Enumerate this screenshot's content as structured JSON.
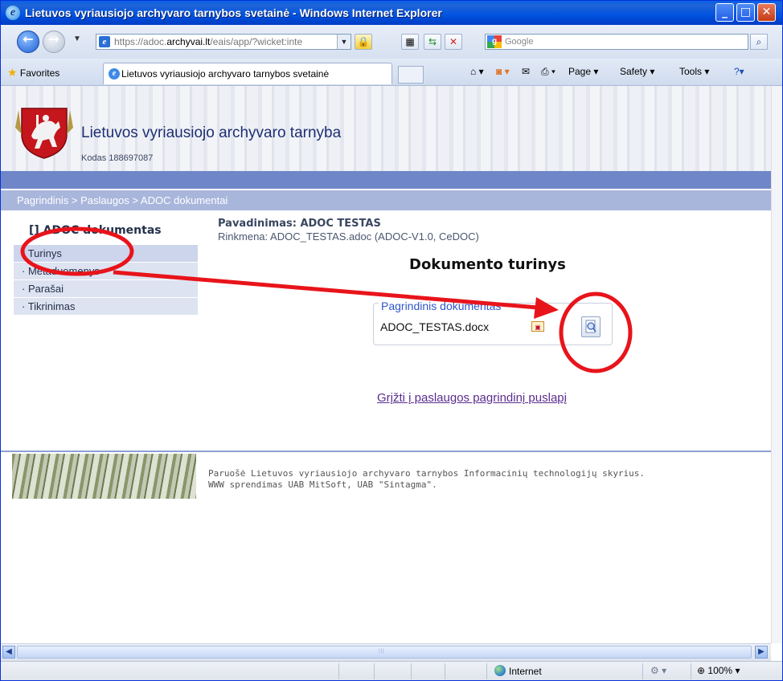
{
  "window": {
    "title": "Lietuvos vyriausiojo archyvaro tarnybos svetainė - Windows Internet Explorer",
    "min": "_",
    "max": "□",
    "close": "✕"
  },
  "address": {
    "url_prefix": "https://adoc.",
    "url_domain": "archyvai.lt",
    "url_rest": "/eais/app/?wicket:inte",
    "search_placeholder": "Google"
  },
  "favorites": {
    "favorites_label": "Favorites",
    "tab_title": "Lietuvos vyriausiojo archyvaro tarnybos svetainė",
    "page_menu": "Page",
    "safety_menu": "Safety",
    "tools_menu": "Tools"
  },
  "site": {
    "title": "Lietuvos vyriausiojo archyvaro tarnyba",
    "code": "Kodas 188697087"
  },
  "breadcrumb": "Pagrindinis  >  Paslaugos  >  ADOC dokumentai",
  "sidebar": {
    "title": "[]  ADOC dokumentas",
    "items": [
      {
        "label": "· Turinys"
      },
      {
        "label": "· Metaduomenys"
      },
      {
        "label": "· Parašai"
      },
      {
        "label": "· Tikrinimas"
      }
    ]
  },
  "document": {
    "name": "Pavadinimas: ADOC TESTAS",
    "file": "Rinkmena: ADOC_TESTAS.adoc (ADOC-V1.0, CeDOC)",
    "heading": "Dokumento turinys",
    "legend": "Pagrindinis dokumentas",
    "main_file": "ADOC_TESTAS.docx",
    "back_link": "Grįžti į paslaugos pagrindinį puslapį"
  },
  "footer": {
    "line1": "Paruošė Lietuvos vyriausiojo archyvaro tarnybos Informacinių technologijų skyrius.",
    "line2": "WWW sprendimas UAB MitSoft, UAB \"Sintagma\"."
  },
  "status": {
    "zone": "Internet",
    "zoom": "100%"
  },
  "colors": {
    "annotation": "#e8141b",
    "nav_band": "#6f86c8",
    "breadcrumb_band": "#a9b6dc",
    "link_visited": "#5b2d8f"
  }
}
